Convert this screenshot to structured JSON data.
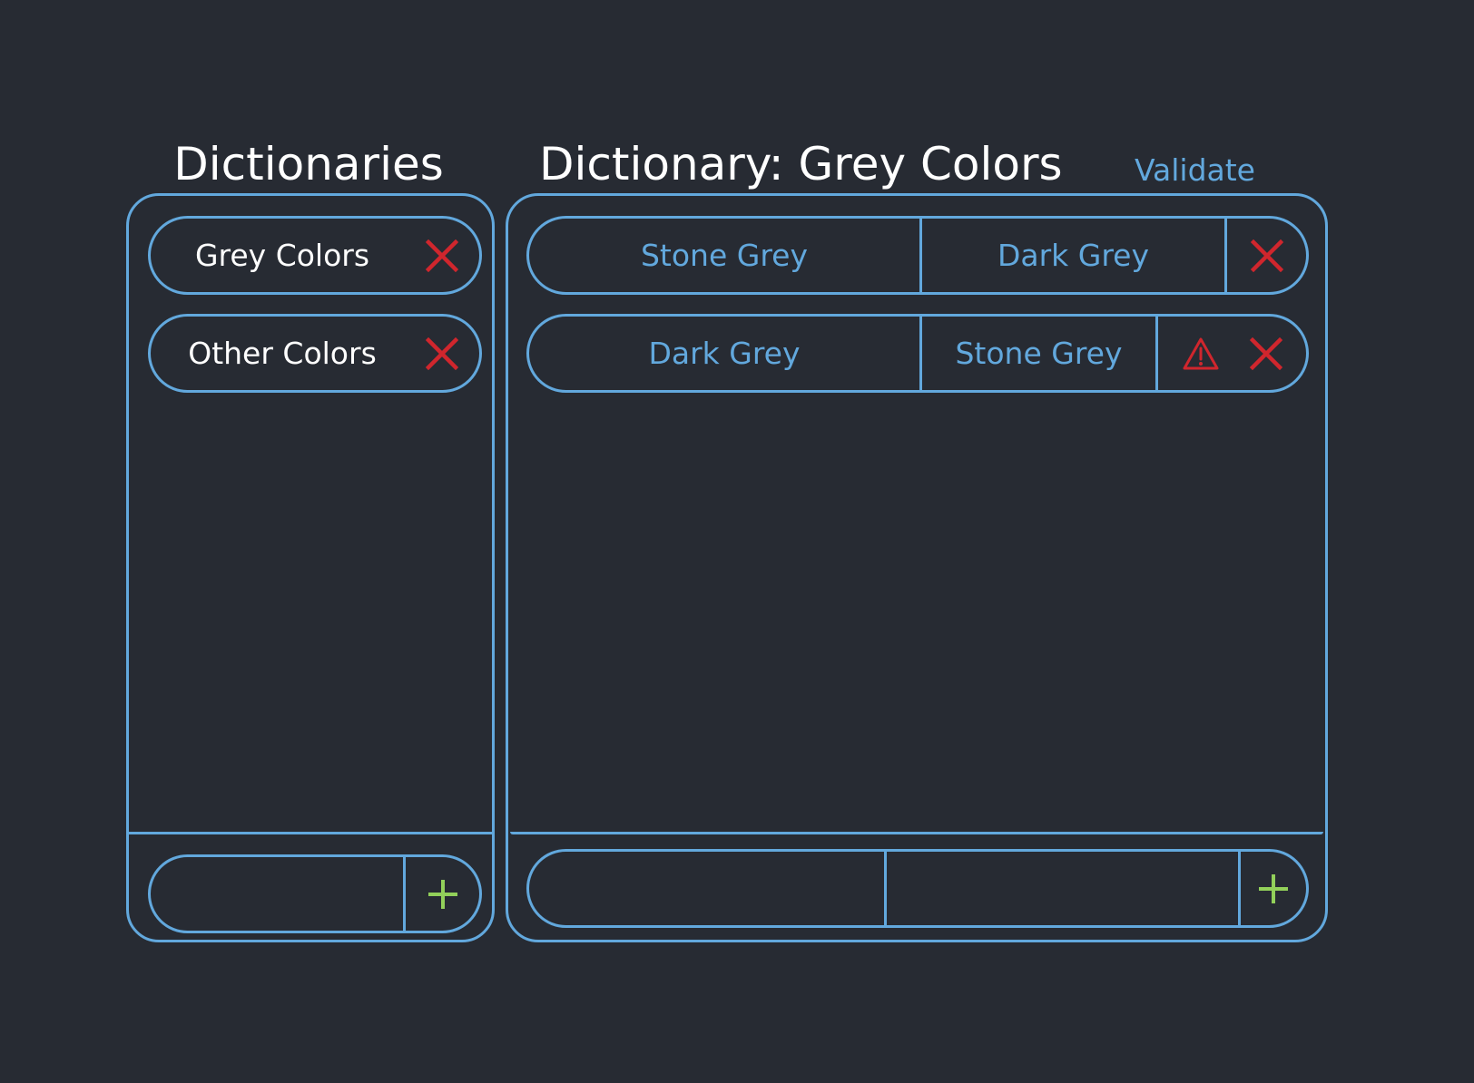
{
  "colors": {
    "background": "#272b33",
    "accent": "#62a8dd",
    "title": "#ffffff",
    "danger": "#d0262d",
    "success": "#92d05a"
  },
  "dictionaries": {
    "title": "Dictionaries",
    "items": [
      {
        "label": "Grey Colors",
        "delete_icon": "close-icon"
      },
      {
        "label": "Other Colors",
        "delete_icon": "close-icon"
      }
    ],
    "add": {
      "input_value": "",
      "input_placeholder": "",
      "add_icon": "plus-icon"
    }
  },
  "detail": {
    "title": "Dictionary: Grey Colors",
    "validate_label": "Validate",
    "entries": [
      {
        "domain": "Stone Grey",
        "range": "Dark Grey",
        "warning": false,
        "delete_icon": "close-icon"
      },
      {
        "domain": "Dark Grey",
        "range": "Stone Grey",
        "warning": true,
        "warning_icon": "warning-icon",
        "delete_icon": "close-icon"
      }
    ],
    "add": {
      "domain_value": "",
      "domain_placeholder": "",
      "range_value": "",
      "range_placeholder": "",
      "add_icon": "plus-icon"
    }
  }
}
